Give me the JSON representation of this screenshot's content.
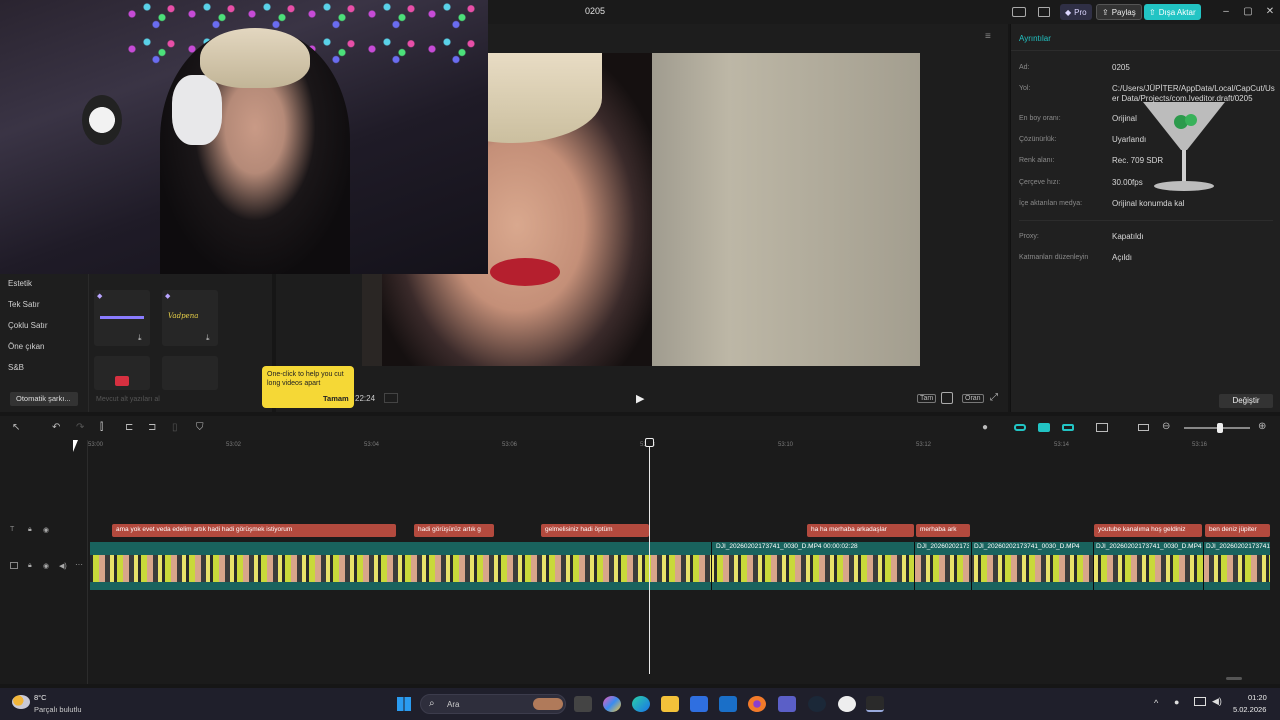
{
  "titlebar": {
    "project_title": "0205",
    "pro_label": "Pro",
    "share_label": "Paylaş",
    "export_label": "Dışa Aktar",
    "minimize": "–",
    "maximize": "▢",
    "close": "✕"
  },
  "details": {
    "header": "Ayrıntılar",
    "rows": [
      {
        "label": "Ad:",
        "value": "0205"
      },
      {
        "label": "Yol:",
        "value": "C:/Users/JÜPİTER/AppData/Local/CapCut/User Data/Projects/com.lveditor.draft/0205"
      },
      {
        "label": "En boy oranı:",
        "value": "Orijinal"
      },
      {
        "label": "Çözünürlük:",
        "value": "Uyarlandı"
      },
      {
        "label": "Renk alanı:",
        "value": "Rec. 709 SDR"
      },
      {
        "label": "Çerçeve hızı:",
        "value": "30.00fps"
      },
      {
        "label": "İçe aktarılan medya:",
        "value": "Orijinal konumda kal"
      },
      {
        "label": "Proxy:",
        "value": "Kapatıldı"
      },
      {
        "label": "Katmanları düzenleyin",
        "value": "Açıldı"
      }
    ],
    "change_button": "Değiştir"
  },
  "left_panel": {
    "categories": [
      "Estetik",
      "Tek Satır",
      "Çoklu Satır",
      "Öne çıkan",
      "S&B"
    ],
    "auto_lyrics": "Otomatik şarkı...",
    "current_text_option": "Mevcut alt yazıları al",
    "tile_text": "Vadpena"
  },
  "tooltip": {
    "text": "One-click to help you cut long videos apart",
    "ok": "Tamam"
  },
  "preview": {
    "time": "22:24",
    "full_label": "Tam",
    "ratio_label": "Oran"
  },
  "ruler": [
    "53:00",
    "53:02",
    "53:04",
    "53:06",
    "53:08",
    "53:10",
    "53:12",
    "53:14",
    "53:16"
  ],
  "captions": [
    "ama yok evet veda edelim artık hadi hadi görüşmek istiyorum",
    "hadi görüşürüz artık g",
    "gelmelisiniz hadi öptüm",
    "ha ha merhaba arkadaşlar",
    "merhaba ark",
    "youtube kanalıma hoş geldiniz",
    "ben deniz jüpiter"
  ],
  "clips": [
    "DJI_20260202173741_0030_D.MP4   00:00:02:28",
    "DJI_20260202173",
    "DJI_20260202173741_0030_D.MP4",
    "DJI_20260202173741_0030_D.MP4",
    "DJI_20260202173741_0030_D.MP4"
  ],
  "taskbar": {
    "temperature": "8°C",
    "weather": "Parçalı bulutlu",
    "search": "Ara",
    "time": "01:20",
    "date": "5.02.2026"
  }
}
